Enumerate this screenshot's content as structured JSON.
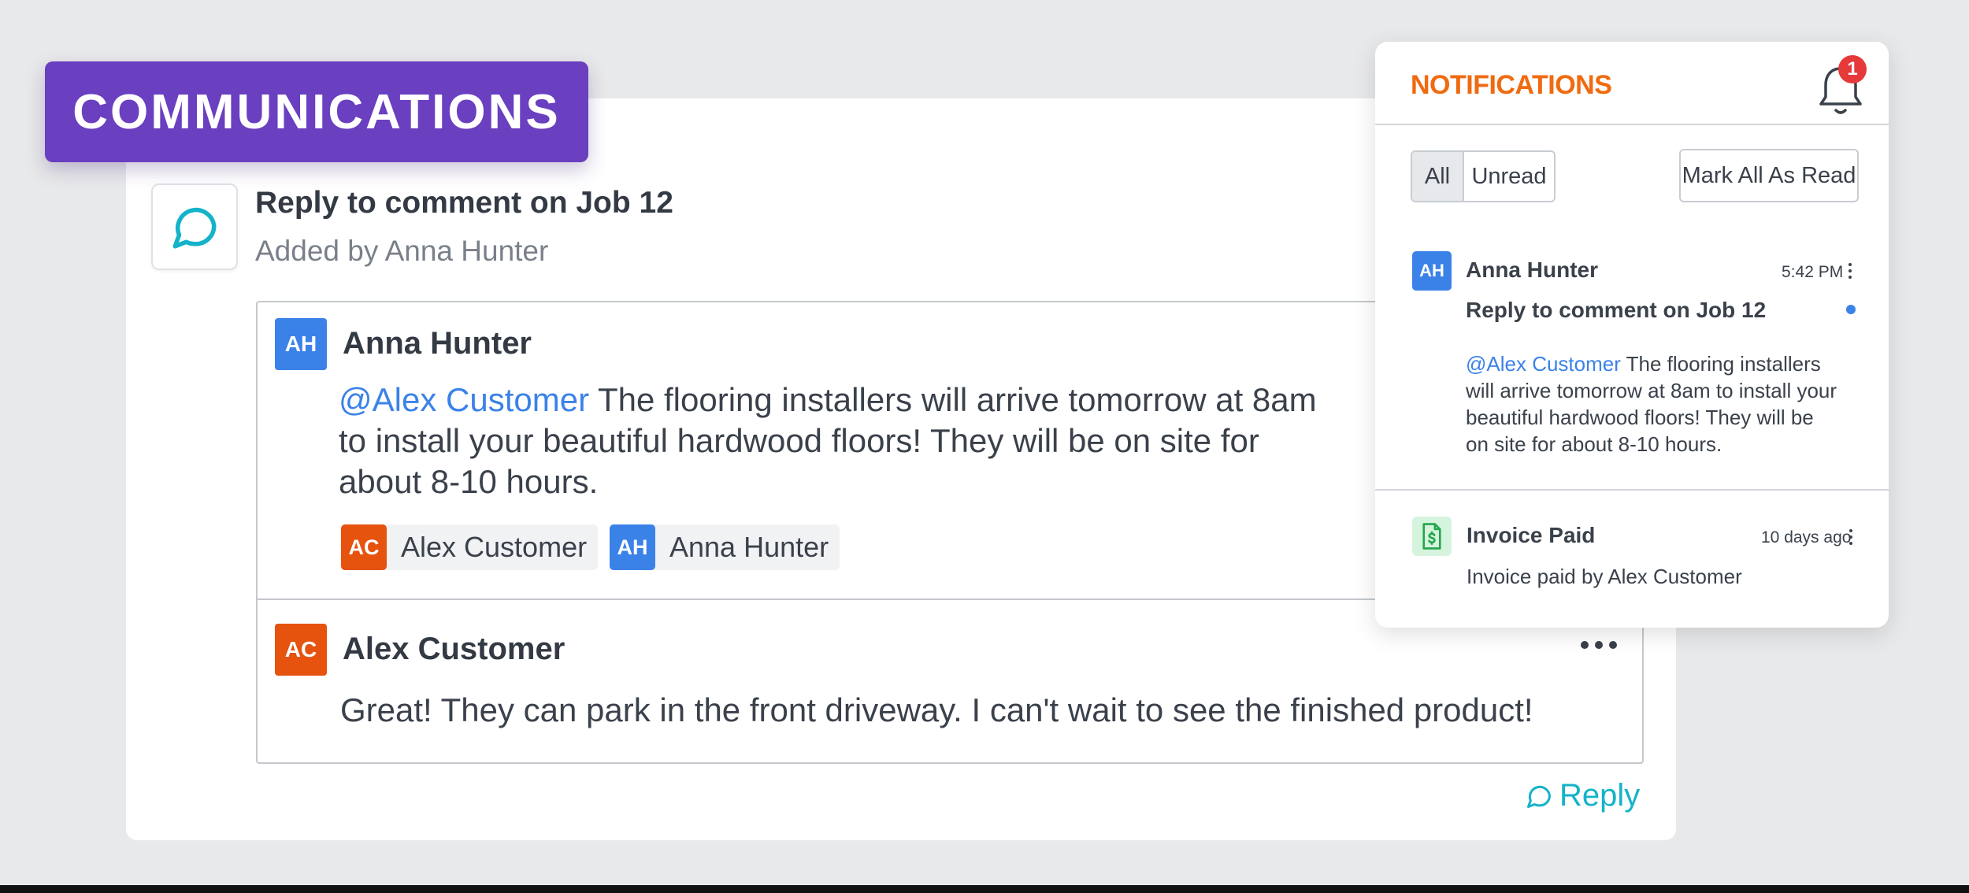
{
  "banner": {
    "label": "COMMUNICATIONS"
  },
  "activity": {
    "title": "Reply to comment on Job 12",
    "subtitle": "Added by Anna Hunter"
  },
  "thread": {
    "comments": [
      {
        "initials": "AH",
        "author": "Anna Hunter",
        "mention": "@Alex Customer",
        "text_line1": " The flooring installers will arrive tomorrow at 8am",
        "text_line2": "to install your beautiful hardwood floors! They will be on site for",
        "text_line3": "about 8-10 hours.",
        "tagged": [
          {
            "initials": "AC",
            "name": "Alex Customer"
          },
          {
            "initials": "AH",
            "name": "Anna Hunter"
          }
        ]
      },
      {
        "initials": "AC",
        "author": "Alex Customer",
        "text": "Great! They can park in the front driveway. I can't wait to see the finished product!"
      }
    ],
    "reply_label": "Reply"
  },
  "notifications": {
    "title": "NOTIFICATIONS",
    "badge_count": "1",
    "filters": {
      "all": "All",
      "unread": "Unread"
    },
    "mark_all_label": "Mark All As Read",
    "items": [
      {
        "initials": "AH",
        "author": "Anna Hunter",
        "time": "5:42 PM",
        "subject": "Reply to comment on Job 12",
        "unread": true,
        "mention": "@Alex Customer",
        "body_line1": " The flooring installers",
        "body_line2": "will arrive tomorrow at 8am to install your",
        "body_line3": "beautiful hardwood floors! They will be",
        "body_line4": "on site for about 8-10 hours."
      },
      {
        "icon": "invoice-dollar-icon",
        "title": "Invoice Paid",
        "time": "10 days ago",
        "body": "Invoice paid by Alex Customer"
      }
    ]
  },
  "colors": {
    "banner_bg": "#6a3fc0",
    "accent_orange": "#f06a10",
    "avatar_blue": "#3b82e8",
    "avatar_orange": "#e5530e",
    "reply_teal": "#14b3c9",
    "badge_red": "#e5393a"
  }
}
